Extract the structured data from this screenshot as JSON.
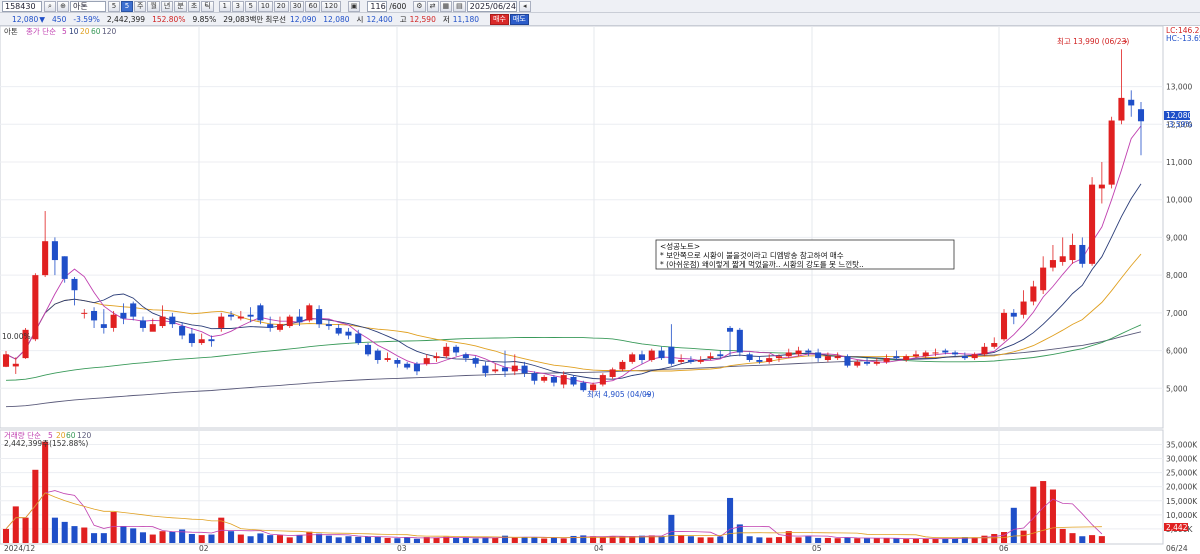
{
  "toolbar": {
    "code": "158430",
    "name": "아톤",
    "period_buttons": [
      "주",
      "월",
      "년",
      "분",
      "초",
      "틱"
    ],
    "interval_buttons": [
      "1",
      "3",
      "5",
      "10",
      "20",
      "30",
      "60",
      "120"
    ],
    "count": "116",
    "total": "600",
    "date": "2025/06/24",
    "dropdown_selected": "5"
  },
  "quote": {
    "price": "12,080",
    "change": "450",
    "change_pct": "-3.59%",
    "volume": "2,442,399",
    "vol_ratio": "152.80%",
    "turnover": "9.85%",
    "amount_label": "29,083백만",
    "pref_label": "최우선",
    "pref_value": "12,090",
    "pref_value2": "12,080",
    "open_label": "시",
    "open_value": "12,400",
    "high_label": "고",
    "high_value": "12,590",
    "low_label": "저",
    "low_value": "11,180",
    "buy_label": "매수",
    "sell_label": "매도"
  },
  "price_panel": {
    "legend_name": "아톤",
    "legend_ma_label": "종가 단순",
    "legend_periods": [
      "5",
      "10",
      "20",
      "60",
      "120"
    ],
    "axis_top_lc": "LC:146.28",
    "axis_top_hc": "HC:-13.65",
    "current_price_tag": "12,080",
    "current_pct_tag": "-3.59%",
    "high_annotation": "최고 13,990 (06/23)",
    "low_annotation": "최저 4,905 (04/09)",
    "left_pct_label": "10.00%",
    "note_title": "<성공노트>",
    "note_line1": "* 보안쪽으로 시황이 불을것이라고 디엠방송 참고하여 매수",
    "note_line2": "* (아쉬운점) 왜이렇게 짧게 먹었을까.. 시황의 강도를 못 느낀탓.."
  },
  "volume_panel": {
    "legend_label": "거래량 단순",
    "legend_periods": [
      "5",
      "20",
      "60",
      "120"
    ],
    "current_value": "2,442,399주(152.88%)",
    "tag_value": "2,442"
  },
  "x_axis_labels": [
    "2024/12",
    "02",
    "03",
    "04",
    "05",
    "06",
    "06/24"
  ],
  "chart_data": {
    "type": "candlestick",
    "price_axis": {
      "min": 4000,
      "max": 14500,
      "ticks": [
        5000,
        6000,
        7000,
        8000,
        9000,
        10000,
        11000,
        12000,
        13000
      ]
    },
    "price_tick_labels": [
      "5,000",
      "6,000",
      "7,000",
      "8,000",
      "9,000",
      "10,000",
      "11,000",
      "12,000",
      "13,000"
    ],
    "volume_axis": {
      "min": 0,
      "max": 38000,
      "ticks": [
        5000,
        10000,
        15000,
        20000,
        25000,
        30000,
        35000
      ]
    },
    "volume_tick_labels": [
      "5,000K",
      "10,000K",
      "15,000K",
      "20,000K",
      "25,000K",
      "30,000K",
      "35,000K"
    ],
    "ma_colors": {
      "5": "#c040b0",
      "10": "#2b3d78",
      "20": "#e0a020",
      "60": "#3a9a5a",
      "120": "#5a5a7a"
    },
    "up_color": "#e02020",
    "down_color": "#1f4fc8",
    "candles": [
      [
        5570,
        5900,
        5560,
        5990
      ],
      [
        5580,
        5650,
        5380,
        5820
      ],
      [
        5800,
        6550,
        5780,
        6600
      ],
      [
        6300,
        8000,
        6250,
        8050
      ],
      [
        8000,
        8900,
        7950,
        9700
      ],
      [
        8900,
        8400,
        8000,
        9000
      ],
      [
        8500,
        7900,
        7800,
        8500
      ],
      [
        7900,
        7600,
        7200,
        7950
      ],
      [
        7000,
        7000,
        6850,
        7100
      ],
      [
        7050,
        6800,
        6600,
        7150
      ],
      [
        6700,
        6600,
        6450,
        7100
      ],
      [
        6600,
        6950,
        6500,
        7050
      ],
      [
        7000,
        6850,
        6700,
        7250
      ],
      [
        7250,
        6900,
        6800,
        7300
      ],
      [
        6800,
        6600,
        6500,
        6900
      ],
      [
        6500,
        6700,
        6550,
        6850
      ],
      [
        6650,
        6900,
        6600,
        7200
      ],
      [
        6900,
        6700,
        6600,
        7000
      ],
      [
        6650,
        6400,
        6300,
        6750
      ],
      [
        6450,
        6200,
        6100,
        6600
      ],
      [
        6200,
        6300,
        6150,
        6450
      ],
      [
        6300,
        6250,
        6100,
        6400
      ],
      [
        6600,
        6900,
        6500,
        7000
      ],
      [
        6950,
        6900,
        6800,
        7050
      ],
      [
        6850,
        6900,
        6800,
        7050
      ],
      [
        6950,
        6900,
        6750,
        7150
      ],
      [
        7200,
        6800,
        6700,
        7250
      ],
      [
        6700,
        6600,
        6500,
        6900
      ],
      [
        6550,
        6700,
        6500,
        6900
      ],
      [
        6650,
        6900,
        6600,
        6950
      ],
      [
        6900,
        6750,
        6650,
        7100
      ],
      [
        6800,
        7200,
        6750,
        7250
      ],
      [
        7100,
        6700,
        6600,
        7200
      ],
      [
        6700,
        6650,
        6550,
        6800
      ],
      [
        6600,
        6450,
        6400,
        6700
      ],
      [
        6500,
        6400,
        6300,
        6600
      ],
      [
        6450,
        6200,
        6150,
        6550
      ],
      [
        6150,
        5900,
        5850,
        6200
      ],
      [
        6000,
        5750,
        5650,
        6050
      ],
      [
        5750,
        5800,
        5700,
        5950
      ],
      [
        5750,
        5650,
        5550,
        5800
      ],
      [
        5650,
        5550,
        5500,
        5700
      ],
      [
        5650,
        5450,
        5350,
        5700
      ],
      [
        5650,
        5800,
        5600,
        5900
      ],
      [
        5800,
        5850,
        5700,
        5950
      ],
      [
        5850,
        6100,
        5800,
        6200
      ],
      [
        6100,
        5950,
        5850,
        6150
      ],
      [
        5900,
        5800,
        5700,
        5950
      ],
      [
        5800,
        5650,
        5550,
        5850
      ],
      [
        5600,
        5400,
        5300,
        5700
      ],
      [
        5450,
        5500,
        5400,
        5650
      ],
      [
        5550,
        5450,
        5300,
        6000
      ],
      [
        5450,
        5600,
        5350,
        5900
      ],
      [
        5600,
        5400,
        5300,
        5700
      ],
      [
        5400,
        5200,
        5100,
        5450
      ],
      [
        5200,
        5300,
        5150,
        5350
      ],
      [
        5300,
        5150,
        5050,
        5350
      ],
      [
        5100,
        5350,
        5000,
        5450
      ],
      [
        5300,
        5100,
        5050,
        5350
      ],
      [
        5150,
        4950,
        4905,
        5200
      ],
      [
        4950,
        5100,
        4905,
        5150
      ],
      [
        5100,
        5350,
        5050,
        5400
      ],
      [
        5300,
        5500,
        5250,
        5550
      ],
      [
        5500,
        5700,
        5450,
        5750
      ],
      [
        5700,
        5900,
        5650,
        5950
      ],
      [
        5900,
        5750,
        5650,
        6000
      ],
      [
        5750,
        6000,
        5700,
        6050
      ],
      [
        6000,
        5800,
        5750,
        6100
      ],
      [
        6100,
        5650,
        5600,
        6700
      ],
      [
        5700,
        5750,
        5650,
        5900
      ],
      [
        5750,
        5700,
        5650,
        5850
      ],
      [
        5700,
        5750,
        5650,
        5850
      ],
      [
        5800,
        5850,
        5750,
        5950
      ],
      [
        5900,
        5850,
        5800,
        6000
      ],
      [
        6600,
        6500,
        5850,
        6650
      ],
      [
        6550,
        5950,
        5850,
        6600
      ],
      [
        5900,
        5750,
        5700,
        5950
      ],
      [
        5750,
        5700,
        5650,
        5850
      ],
      [
        5700,
        5800,
        5650,
        5900
      ],
      [
        5800,
        5850,
        5700,
        5900
      ],
      [
        5850,
        5950,
        5800,
        6050
      ],
      [
        5900,
        6000,
        5850,
        6100
      ],
      [
        6000,
        5950,
        5850,
        6050
      ],
      [
        5950,
        5800,
        5700,
        6050
      ],
      [
        5750,
        5850,
        5700,
        5950
      ],
      [
        5800,
        5850,
        5750,
        5950
      ],
      [
        5850,
        5600,
        5550,
        5900
      ],
      [
        5600,
        5700,
        5550,
        5750
      ],
      [
        5700,
        5650,
        5600,
        5800
      ],
      [
        5650,
        5700,
        5600,
        5800
      ],
      [
        5700,
        5800,
        5650,
        5900
      ],
      [
        5850,
        5800,
        5750,
        6000
      ],
      [
        5750,
        5850,
        5700,
        5900
      ],
      [
        5850,
        5900,
        5800,
        6000
      ],
      [
        5850,
        5950,
        5800,
        6000
      ],
      [
        5950,
        5950,
        5850,
        6050
      ],
      [
        6000,
        5950,
        5900,
        6050
      ],
      [
        5950,
        5900,
        5850,
        6000
      ],
      [
        5850,
        5800,
        5750,
        5950
      ],
      [
        5800,
        5900,
        5750,
        5950
      ],
      [
        5900,
        6100,
        5850,
        6200
      ],
      [
        6100,
        6200,
        6050,
        6350
      ],
      [
        6300,
        7000,
        6250,
        7100
      ],
      [
        7000,
        6900,
        6700,
        7100
      ],
      [
        6950,
        7300,
        6850,
        7600
      ],
      [
        7300,
        7700,
        7200,
        7850
      ],
      [
        7600,
        8200,
        7500,
        8500
      ],
      [
        8200,
        8400,
        8100,
        8800
      ],
      [
        8350,
        8500,
        8250,
        9000
      ],
      [
        8400,
        8800,
        8300,
        9100
      ],
      [
        8800,
        8300,
        8200,
        9000
      ],
      [
        8300,
        10400,
        8250,
        10600
      ],
      [
        10300,
        10400,
        9900,
        11000
      ],
      [
        10400,
        12100,
        10300,
        12200
      ],
      [
        12100,
        12700,
        12000,
        13990
      ],
      [
        12650,
        12500,
        12200,
        12900
      ],
      [
        12400,
        12080,
        11180,
        12590
      ]
    ],
    "volume": [
      5000,
      13000,
      9000,
      26000,
      36000,
      9000,
      7500,
      6000,
      5500,
      3500,
      3500,
      11000,
      6000,
      5200,
      3800,
      3000,
      4200,
      4000,
      4800,
      3200,
      2800,
      3000,
      9000,
      4200,
      3000,
      2400,
      3400,
      2800,
      2800,
      2000,
      2800,
      4000,
      3300,
      2600,
      2000,
      2400,
      2200,
      2300,
      2200,
      1800,
      1700,
      2000,
      1500,
      2100,
      1900,
      2200,
      1800,
      1800,
      1600,
      2000,
      1900,
      2600,
      1900,
      2100,
      2000,
      1600,
      2000,
      1600,
      2500,
      2700,
      2400,
      2100,
      2400,
      2300,
      2400,
      2600,
      2700,
      2500,
      10000,
      2800,
      2400,
      2000,
      2000,
      2300,
      16000,
      6600,
      2400,
      2000,
      1900,
      2100,
      4200,
      2000,
      2400,
      1800,
      1800,
      1700,
      2000,
      1700,
      1700,
      1600,
      1700,
      1600,
      1400,
      1500,
      1600,
      1600,
      1600,
      1600,
      2100,
      2000,
      2600,
      3200,
      3900,
      12500,
      4400,
      20000,
      22000,
      19000,
      5000,
      3500,
      2400,
      2800,
      2442
    ]
  }
}
